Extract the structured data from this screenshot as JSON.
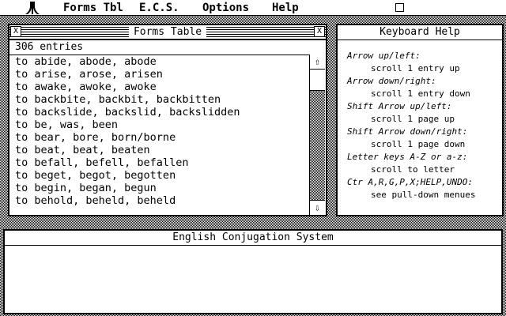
{
  "menubar": {
    "items": [
      {
        "label": "Forms Tbl"
      },
      {
        "label": "E.C.S."
      },
      {
        "label": "Options"
      },
      {
        "label": "Help"
      }
    ]
  },
  "forms_window": {
    "title": "Forms Table",
    "close_glyph": "X",
    "full_glyph": "X",
    "entry_count": "306 entries",
    "entries": [
      "to abide, abode, abode",
      "to arise, arose, arisen",
      "to awake, awoke, awoke",
      "to backbite, backbit, backbitten",
      "to backslide, backslid, backslidden",
      "to be, was, been",
      "to bear, bore, born/borne",
      "to beat, beat, beaten",
      "to befall, befell, befallen",
      "to beget, begot, begotten",
      "to begin, began, begun",
      "to behold, beheld, beheld"
    ],
    "scroll_up_glyph": "⇧",
    "scroll_down_glyph": "⇩"
  },
  "help_window": {
    "title": "Keyboard Help",
    "items": [
      {
        "key": "Arrow up/left:",
        "desc": "scroll 1 entry up"
      },
      {
        "key": "Arrow down/right:",
        "desc": "scroll 1 entry down"
      },
      {
        "key": "Shift Arrow up/left:",
        "desc": "scroll 1 page up"
      },
      {
        "key": "Shift Arrow down/right:",
        "desc": "scroll 1 page down"
      },
      {
        "key": "Letter keys A-Z or a-z:",
        "desc": "scroll to letter"
      },
      {
        "key": "Ctr A,R,G,P,X;HELP,UNDO:",
        "desc": "see pull-down menues"
      }
    ]
  },
  "ecs_window": {
    "title": "English Conjugation System"
  }
}
